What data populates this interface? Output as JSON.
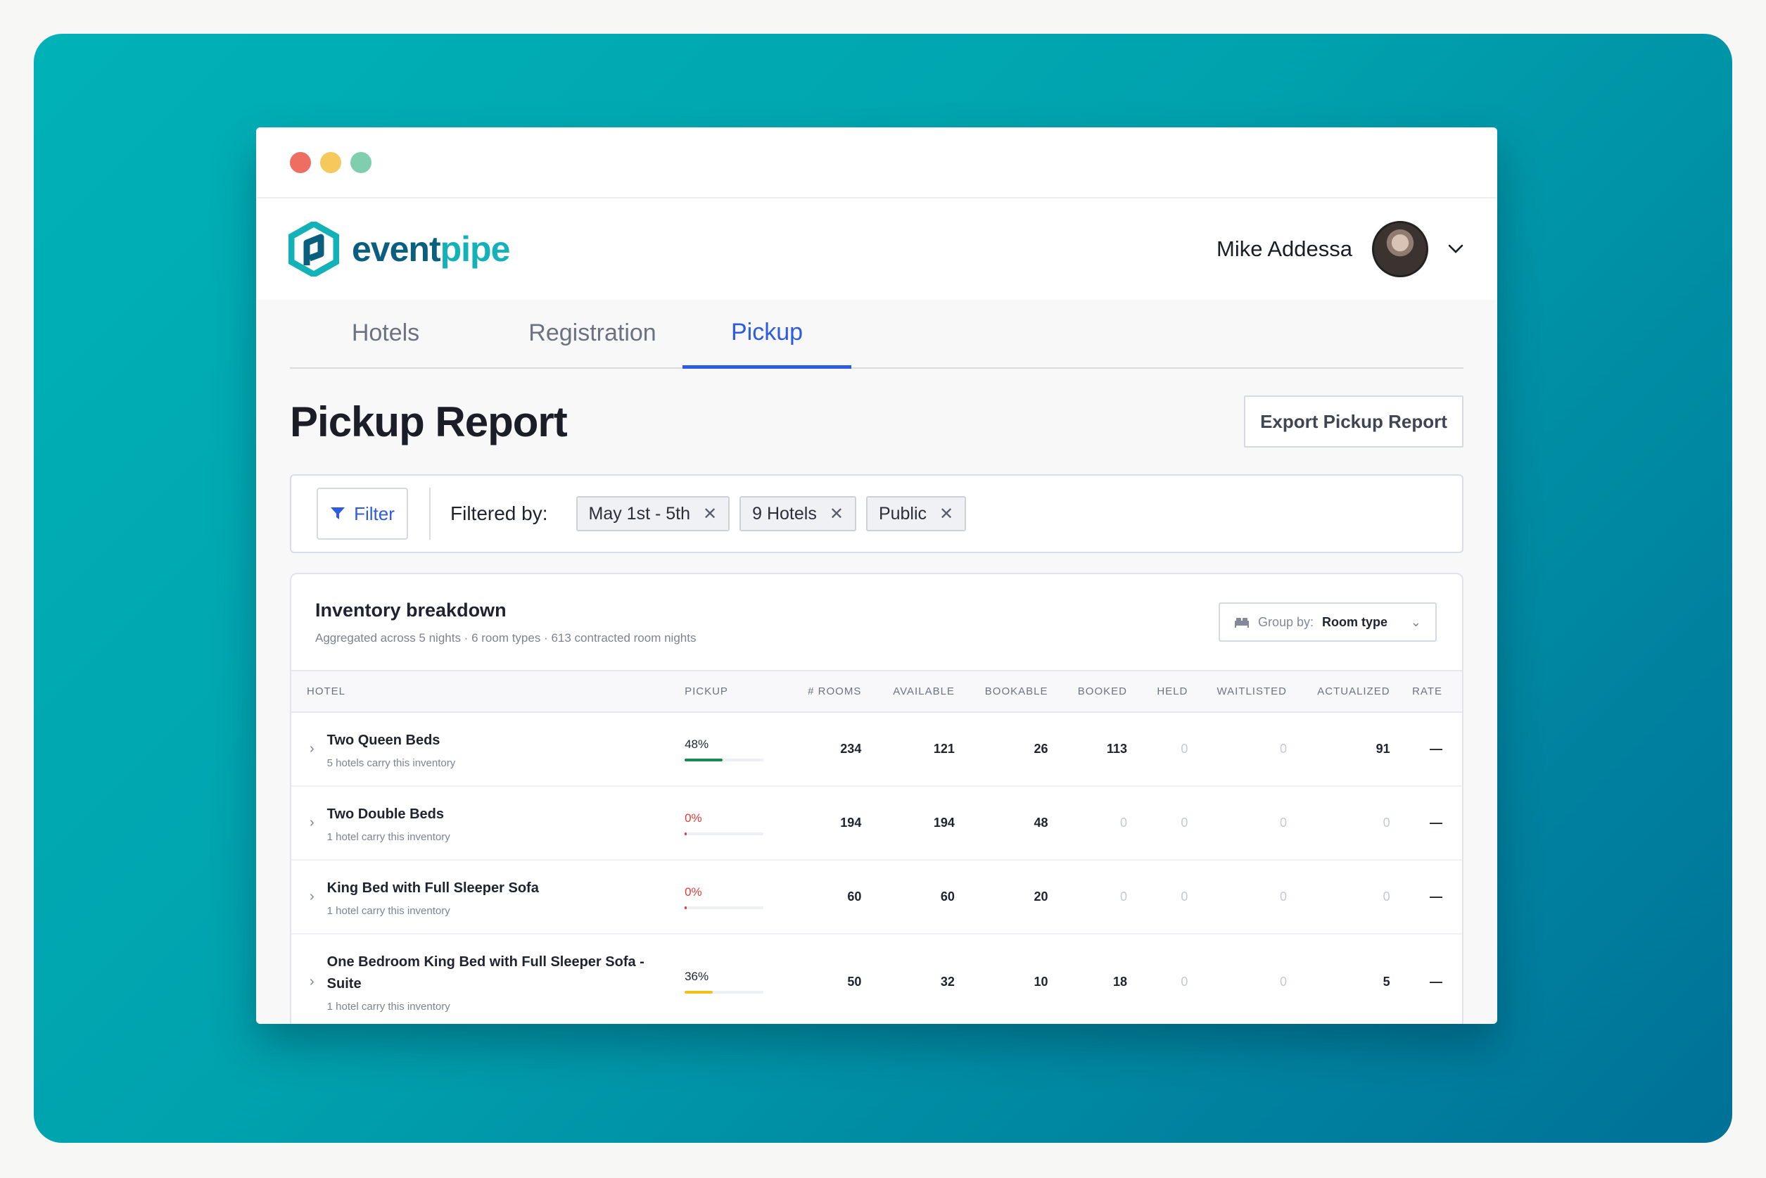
{
  "app": {
    "brand_part1": "event",
    "brand_part2": "pipe",
    "user_name": "Mike Addessa"
  },
  "tabs": [
    {
      "label": "Hotels",
      "active": false
    },
    {
      "label": "Registration",
      "active": false
    },
    {
      "label": "Pickup",
      "active": true
    }
  ],
  "page": {
    "title": "Pickup Report",
    "export_label": "Export Pickup Report"
  },
  "filter": {
    "button_label": "Filter",
    "filtered_by_label": "Filtered by:",
    "chips": [
      "May 1st - 5th",
      "9 Hotels",
      "Public"
    ]
  },
  "inventory": {
    "title": "Inventory breakdown",
    "subtitle": "Aggregated across 5 nights · 6 room types · 613 contracted room nights",
    "group_by_label": "Group by:",
    "group_by_value": "Room type",
    "columns": [
      "HOTEL",
      "PICKUP",
      "# ROOMS",
      "AVAILABLE",
      "BOOKABLE",
      "BOOKED",
      "HELD",
      "WAITLISTED",
      "ACTUALIZED",
      "RATE"
    ],
    "rows": [
      {
        "name": "Two Queen Beds",
        "sub": "5 hotels carry this inventory",
        "pickup": "48%",
        "pickup_value": 0.48,
        "pickup_color": "#1a8a55",
        "rooms": "234",
        "available": "121",
        "bookable": "26",
        "booked": "113",
        "held": "0",
        "waitlisted": "0",
        "actualized": "91",
        "rate": "—"
      },
      {
        "name": "Two Double Beds",
        "sub": "1 hotel carry this inventory",
        "pickup": "0%",
        "pickup_value": 0,
        "pickup_color": "#e53b3b",
        "rooms": "194",
        "available": "194",
        "bookable": "48",
        "booked": "0",
        "held": "0",
        "waitlisted": "0",
        "actualized": "0",
        "rate": "—"
      },
      {
        "name": "King Bed with Full Sleeper Sofa",
        "sub": "1 hotel carry this inventory",
        "pickup": "0%",
        "pickup_value": 0,
        "pickup_color": "#e53b3b",
        "rooms": "60",
        "available": "60",
        "bookable": "20",
        "booked": "0",
        "held": "0",
        "waitlisted": "0",
        "actualized": "0",
        "rate": "—"
      },
      {
        "name": "One Bedroom King Bed with Full Sleeper Sofa - Suite",
        "sub": "1 hotel carry this inventory",
        "pickup": "36%",
        "pickup_value": 0.36,
        "pickup_color": "#f2c21b",
        "rooms": "50",
        "available": "32",
        "bookable": "10",
        "booked": "18",
        "held": "0",
        "waitlisted": "0",
        "actualized": "5",
        "rate": "—"
      }
    ]
  },
  "colors": {
    "accent": "#2d5be3",
    "brand_dark": "#0b5f7e",
    "brand_light": "#12b2b8"
  }
}
